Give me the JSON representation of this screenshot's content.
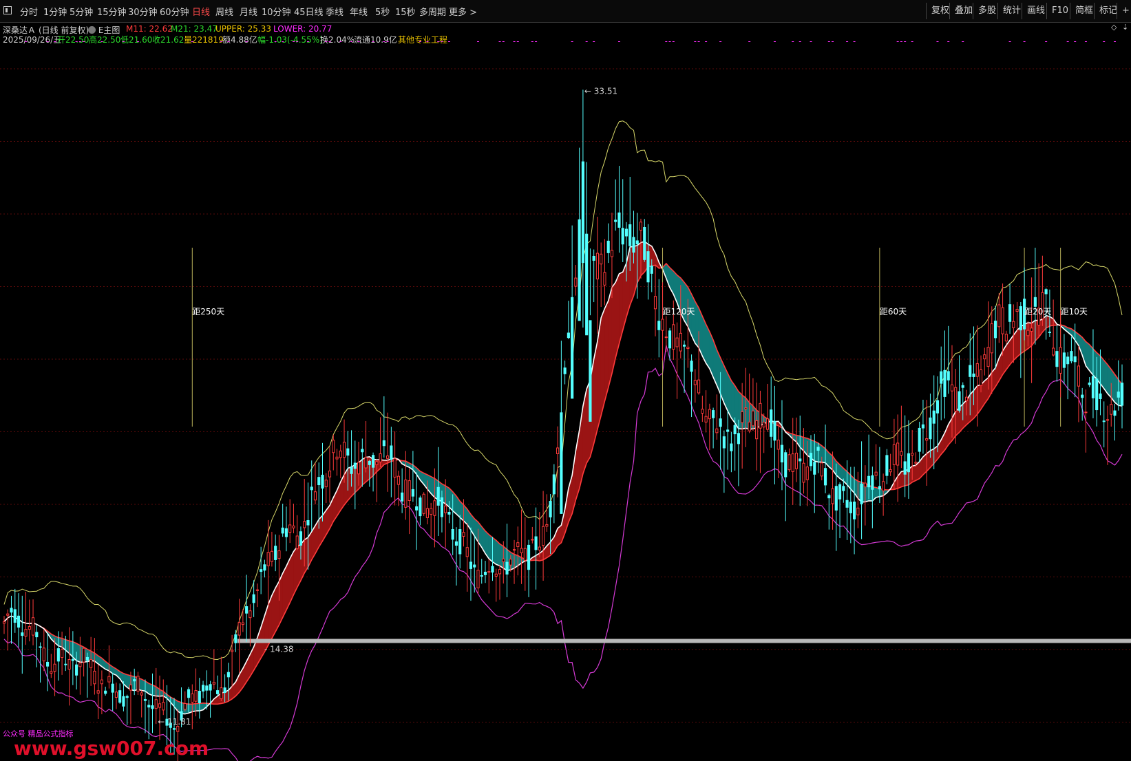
{
  "toolbar": {
    "left_buttons": [
      "分时",
      "1分钟",
      "5分钟",
      "15分钟",
      "30分钟",
      "60分钟",
      "日线",
      "周线",
      "月线",
      "10分钟",
      "45日线",
      "季线",
      "年线",
      "5秒",
      "15秒",
      "多周期",
      "更多 >"
    ],
    "active": "日线",
    "right_buttons": [
      "复权",
      "叠加",
      "多股",
      "统计",
      "画线",
      "F10",
      "简框",
      "标记",
      "+自"
    ]
  },
  "info": {
    "stock_name": "深桑达Ａ",
    "adj_mode": "(日线 前复权)",
    "main_label": "E主图",
    "date": "2025/09/26/五",
    "open": "开22.50",
    "high": "高22.50",
    "low": "低21.60",
    "close": "收21.62",
    "volume": "量221819",
    "amount": "额4.88亿",
    "change": "幅-1.03(-4.55%)",
    "turnover": "换2.04%",
    "float_cap": "流通10.9亿",
    "extra": "其他专业工程"
  },
  "indicators": {
    "m11": "M11: 22.62",
    "m21": "M21: 23.47",
    "upper": "UPPER: 25.33",
    "lower": "LOWER: 20.77"
  },
  "colors": {
    "up": "#ff3b3b",
    "down": "#54ffff",
    "up_fill": "#9a1414",
    "down_fill": "#0f7a78",
    "m11": "#ffffff",
    "upper": "#d8d86a",
    "lower": "#d63ad6",
    "magenta": "#ff2bff",
    "yellow": "#e8c000",
    "green": "#2bd62b"
  },
  "chart_data": {
    "type": "candlestick",
    "price_range": [
      10.5,
      35.0
    ],
    "high_marker": "33.51",
    "low_marker": "11.81",
    "ref_marker": "14.38",
    "ref_price": 14.38,
    "day_markers": [
      {
        "label": "距250天",
        "index": 52
      },
      {
        "label": "距120天",
        "index": 182
      },
      {
        "label": "距60天",
        "index": 242
      },
      {
        "label": "距20天",
        "index": 282
      },
      {
        "label": "距10天",
        "index": 292
      }
    ],
    "watermark": "www.gsw007.com",
    "wechat": "公众号 精品公式指标",
    "mid_anchors": [
      [
        0,
        15.0
      ],
      [
        25,
        13.2
      ],
      [
        45,
        11.9
      ],
      [
        58,
        12.5
      ],
      [
        68,
        15.6
      ],
      [
        80,
        18.5
      ],
      [
        95,
        21.0
      ],
      [
        100,
        20.8
      ],
      [
        115,
        19.5
      ],
      [
        130,
        17.2
      ],
      [
        140,
        16.8
      ],
      [
        148,
        18.0
      ],
      [
        160,
        27.0
      ],
      [
        170,
        28.5
      ],
      [
        176,
        27.8
      ],
      [
        185,
        25.0
      ],
      [
        195,
        22.0
      ],
      [
        205,
        21.7
      ],
      [
        210,
        21.9
      ],
      [
        220,
        20.5
      ],
      [
        232,
        19.4
      ],
      [
        240,
        19.7
      ],
      [
        250,
        21.0
      ],
      [
        262,
        23.0
      ],
      [
        280,
        25.5
      ],
      [
        286,
        26.3
      ],
      [
        293,
        23.8
      ],
      [
        299,
        23.3
      ],
      [
        308,
        22.4
      ]
    ],
    "spikes": [
      [
        154,
        24.8
      ],
      [
        157,
        28.8
      ],
      [
        159,
        31.5
      ],
      [
        160,
        33.51
      ],
      [
        161,
        31.0
      ],
      [
        162,
        28.0
      ],
      [
        44,
        11.81
      ]
    ]
  }
}
